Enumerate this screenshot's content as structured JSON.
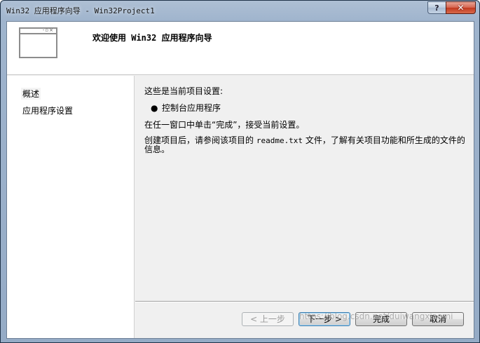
{
  "window": {
    "title": "Win32 应用程序向导 - Win32Project1",
    "help_glyph": "?",
    "close_glyph": "✕"
  },
  "header": {
    "title": "欢迎使用 Win32 应用程序向导",
    "icon": "window-icon"
  },
  "sidebar": {
    "items": [
      {
        "label": "概述",
        "selected": true
      },
      {
        "label": "应用程序设置",
        "selected": false
      }
    ]
  },
  "main": {
    "intro": "这些是当前项目设置:",
    "bullet": "控制台应用程序",
    "finish_hint": "在任一窗口中单击“完成”，接受当前设置。",
    "readme_before": "创建项目后，请参阅该项目的 ",
    "readme_file": "readme.txt",
    "readme_after": " 文件，了解有关项目功能和所生成的文件的信息。"
  },
  "buttons": {
    "prev": "< 上一步",
    "next": "下一步 >",
    "finish": "完成",
    "cancel": "取消"
  },
  "watermark": "https://blog.csdn.net/duiwangxiaomi"
}
